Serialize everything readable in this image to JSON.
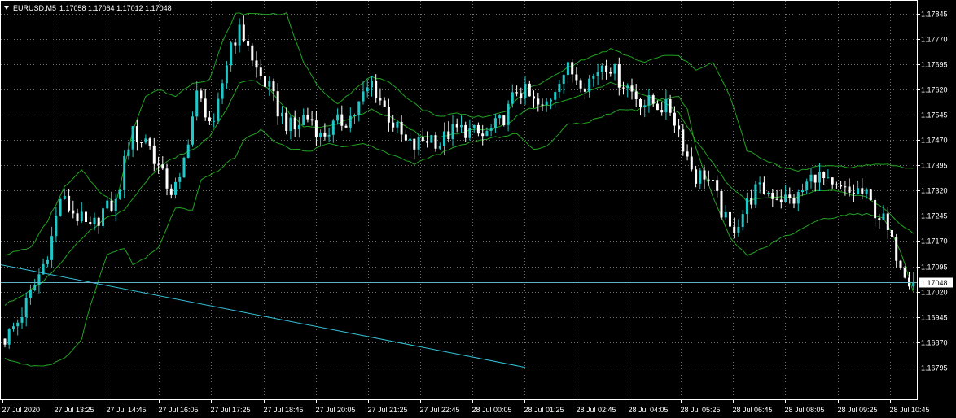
{
  "header": {
    "symbol": "EURUSD,M5",
    "ohlc": "1.17058 1.17064 1.17012 1.17048",
    "arrow_icon": "triangle-down-icon"
  },
  "colors": {
    "background": "#000000",
    "grid": "#c8c8c8",
    "frame": "#ffffff",
    "bull_candle": "#1fc8c8",
    "bear_candle": "#ffffff",
    "bands": "#22a322",
    "trendline": "#35c0d6",
    "bid_line": "#5fb3c3"
  },
  "chart_data": {
    "type": "candlestick",
    "title": "EURUSD,M5",
    "ylim": [
      1.16795,
      1.1787
    ],
    "y_ticks": [
      "1.17845",
      "1.17770",
      "1.17695",
      "1.17620",
      "1.17545",
      "1.17470",
      "1.17395",
      "1.17320",
      "1.17245",
      "1.17170",
      "1.17095",
      "1.17020",
      "1.16945",
      "1.16870",
      "1.16795"
    ],
    "x_ticks": [
      "27 Jul 2020",
      "27 Jul 13:25",
      "27 Jul 14:45",
      "27 Jul 16:05",
      "27 Jul 17:25",
      "27 Jul 18:45",
      "27 Jul 20:05",
      "27 Jul 21:25",
      "27 Jul 22:45",
      "28 Jul 00:05",
      "28 Jul 01:25",
      "28 Jul 02:45",
      "28 Jul 04:05",
      "28 Jul 05:25",
      "28 Jul 06:45",
      "28 Jul 08:05",
      "28 Jul 09:25",
      "28 Jul 10:45"
    ],
    "current_price": "1.17048",
    "price_path": [
      [
        0,
        1.1688
      ],
      [
        3,
        1.1693
      ],
      [
        6,
        1.1701
      ],
      [
        9,
        1.171
      ],
      [
        11,
        1.1718
      ],
      [
        13,
        1.173
      ],
      [
        15,
        1.1727
      ],
      [
        18,
        1.1723
      ],
      [
        20,
        1.172
      ],
      [
        23,
        1.1726
      ],
      [
        26,
        1.1728
      ],
      [
        28,
        1.174
      ],
      [
        30,
        1.1752
      ],
      [
        31,
        1.1746
      ],
      [
        33,
        1.1748
      ],
      [
        35,
        1.1742
      ],
      [
        37,
        1.1736
      ],
      [
        39,
        1.1732
      ],
      [
        41,
        1.1734
      ],
      [
        43,
        1.1748
      ],
      [
        45,
        1.176
      ],
      [
        47,
        1.1756
      ],
      [
        49,
        1.175
      ],
      [
        51,
        1.1764
      ],
      [
        53,
        1.1776
      ],
      [
        55,
        1.1779
      ],
      [
        57,
        1.1776
      ],
      [
        58,
        1.177
      ],
      [
        60,
        1.1766
      ],
      [
        62,
        1.1762
      ],
      [
        64,
        1.1756
      ],
      [
        66,
        1.1752
      ],
      [
        68,
        1.175
      ],
      [
        70,
        1.1754
      ],
      [
        72,
        1.1753
      ],
      [
        74,
        1.1748
      ],
      [
        76,
        1.175
      ],
      [
        78,
        1.1752
      ],
      [
        80,
        1.1753
      ],
      [
        82,
        1.1755
      ],
      [
        84,
        1.176
      ],
      [
        86,
        1.1764
      ],
      [
        88,
        1.1759
      ],
      [
        90,
        1.1754
      ],
      [
        92,
        1.175
      ],
      [
        94,
        1.1746
      ],
      [
        96,
        1.1745
      ],
      [
        98,
        1.1747
      ],
      [
        100,
        1.1748
      ],
      [
        102,
        1.1746
      ],
      [
        104,
        1.1749
      ],
      [
        106,
        1.175
      ],
      [
        108,
        1.175
      ],
      [
        110,
        1.1749
      ],
      [
        112,
        1.1748
      ],
      [
        114,
        1.175
      ],
      [
        116,
        1.1752
      ],
      [
        118,
        1.1756
      ],
      [
        120,
        1.1762
      ],
      [
        122,
        1.1761
      ],
      [
        124,
        1.1758
      ],
      [
        126,
        1.1756
      ],
      [
        128,
        1.176
      ],
      [
        130,
        1.1766
      ],
      [
        132,
        1.1768
      ],
      [
        134,
        1.1766
      ],
      [
        136,
        1.1764
      ],
      [
        138,
        1.1766
      ],
      [
        140,
        1.177
      ],
      [
        142,
        1.1769
      ],
      [
        144,
        1.1765
      ],
      [
        146,
        1.1763
      ],
      [
        148,
        1.176
      ],
      [
        150,
        1.1758
      ],
      [
        152,
        1.1758
      ],
      [
        154,
        1.1757
      ],
      [
        156,
        1.1756
      ],
      [
        158,
        1.175
      ],
      [
        160,
        1.1742
      ],
      [
        162,
        1.1736
      ],
      [
        164,
        1.1737
      ],
      [
        166,
        1.1733
      ],
      [
        168,
        1.1726
      ],
      [
        170,
        1.172
      ],
      [
        172,
        1.1723
      ],
      [
        174,
        1.1728
      ],
      [
        176,
        1.1732
      ],
      [
        178,
        1.1732
      ],
      [
        180,
        1.1731
      ],
      [
        182,
        1.173
      ],
      [
        184,
        1.1729
      ],
      [
        186,
        1.173
      ],
      [
        188,
        1.1734
      ],
      [
        190,
        1.1737
      ],
      [
        192,
        1.1735
      ],
      [
        194,
        1.1732
      ],
      [
        196,
        1.1732
      ],
      [
        198,
        1.1731
      ],
      [
        200,
        1.1732
      ],
      [
        202,
        1.173
      ],
      [
        204,
        1.1726
      ],
      [
        206,
        1.1723
      ],
      [
        208,
        1.1716
      ],
      [
        210,
        1.1711
      ],
      [
        212,
        1.1706
      ],
      [
        213,
        1.17048
      ]
    ],
    "bollinger_upper": [
      [
        0,
        1.1713
      ],
      [
        6,
        1.1715
      ],
      [
        10,
        1.1723
      ],
      [
        14,
        1.1733
      ],
      [
        18,
        1.1738
      ],
      [
        22,
        1.1732
      ],
      [
        26,
        1.1728
      ],
      [
        30,
        1.175
      ],
      [
        33,
        1.176
      ],
      [
        36,
        1.1762
      ],
      [
        40,
        1.176
      ],
      [
        44,
        1.1764
      ],
      [
        48,
        1.1765
      ],
      [
        51,
        1.1776
      ],
      [
        54,
        1.17845
      ],
      [
        66,
        1.17845
      ],
      [
        70,
        1.177
      ],
      [
        74,
        1.1762
      ],
      [
        78,
        1.1758
      ],
      [
        82,
        1.1762
      ],
      [
        86,
        1.1766
      ],
      [
        90,
        1.1764
      ],
      [
        94,
        1.176
      ],
      [
        98,
        1.1756
      ],
      [
        102,
        1.1754
      ],
      [
        106,
        1.1755
      ],
      [
        110,
        1.1754
      ],
      [
        114,
        1.1754
      ],
      [
        118,
        1.1756
      ],
      [
        122,
        1.1762
      ],
      [
        126,
        1.1764
      ],
      [
        130,
        1.1767
      ],
      [
        134,
        1.177
      ],
      [
        138,
        1.1772
      ],
      [
        142,
        1.1774
      ],
      [
        146,
        1.1772
      ],
      [
        150,
        1.177
      ],
      [
        154,
        1.1772
      ],
      [
        158,
        1.1772
      ],
      [
        162,
        1.1768
      ],
      [
        166,
        1.177
      ],
      [
        170,
        1.176
      ],
      [
        174,
        1.1744
      ],
      [
        178,
        1.1741
      ],
      [
        182,
        1.1739
      ],
      [
        186,
        1.1738
      ],
      [
        190,
        1.1739
      ],
      [
        194,
        1.17395
      ],
      [
        198,
        1.1739
      ],
      [
        202,
        1.17395
      ],
      [
        206,
        1.174
      ],
      [
        210,
        1.1739
      ],
      [
        213,
        1.17385
      ]
    ],
    "bollinger_middle": [
      [
        0,
        1.1698
      ],
      [
        4,
        1.1701
      ],
      [
        8,
        1.1704
      ],
      [
        12,
        1.1709
      ],
      [
        16,
        1.1715
      ],
      [
        20,
        1.172
      ],
      [
        24,
        1.1724
      ],
      [
        28,
        1.1726
      ],
      [
        32,
        1.1733
      ],
      [
        36,
        1.1739
      ],
      [
        40,
        1.1742
      ],
      [
        44,
        1.1744
      ],
      [
        48,
        1.1748
      ],
      [
        52,
        1.1756
      ],
      [
        55,
        1.1764
      ],
      [
        58,
        1.1765
      ],
      [
        62,
        1.1762
      ],
      [
        66,
        1.1756
      ],
      [
        70,
        1.1751
      ],
      [
        74,
        1.1751
      ],
      [
        78,
        1.1752
      ],
      [
        82,
        1.1754
      ],
      [
        86,
        1.1756
      ],
      [
        90,
        1.1754
      ],
      [
        94,
        1.1751
      ],
      [
        98,
        1.1748
      ],
      [
        102,
        1.1748
      ],
      [
        106,
        1.1749
      ],
      [
        110,
        1.175
      ],
      [
        114,
        1.175
      ],
      [
        118,
        1.1752
      ],
      [
        122,
        1.1756
      ],
      [
        126,
        1.1757
      ],
      [
        130,
        1.1758
      ],
      [
        134,
        1.176
      ],
      [
        138,
        1.1762
      ],
      [
        142,
        1.1764
      ],
      [
        146,
        1.1763
      ],
      [
        150,
        1.176
      ],
      [
        154,
        1.1759
      ],
      [
        158,
        1.1755
      ],
      [
        162,
        1.1747
      ],
      [
        166,
        1.174
      ],
      [
        170,
        1.1733
      ],
      [
        174,
        1.1729
      ],
      [
        178,
        1.173
      ],
      [
        182,
        1.173
      ],
      [
        186,
        1.173
      ],
      [
        190,
        1.1732
      ],
      [
        194,
        1.1732
      ],
      [
        198,
        1.1731
      ],
      [
        202,
        1.173
      ],
      [
        206,
        1.1727
      ],
      [
        210,
        1.1722
      ],
      [
        213,
        1.1719
      ]
    ],
    "bollinger_lower": [
      [
        0,
        1.1682
      ],
      [
        6,
        1.168
      ],
      [
        10,
        1.168
      ],
      [
        14,
        1.1682
      ],
      [
        18,
        1.1688
      ],
      [
        20,
        1.1698
      ],
      [
        24,
        1.1713
      ],
      [
        28,
        1.1715
      ],
      [
        30,
        1.171
      ],
      [
        33,
        1.1712
      ],
      [
        36,
        1.1715
      ],
      [
        40,
        1.1727
      ],
      [
        44,
        1.1726
      ],
      [
        46,
        1.1735
      ],
      [
        50,
        1.1738
      ],
      [
        54,
        1.1742
      ],
      [
        56,
        1.1747
      ],
      [
        60,
        1.175
      ],
      [
        64,
        1.1746
      ],
      [
        68,
        1.1744
      ],
      [
        72,
        1.1744
      ],
      [
        76,
        1.1746
      ],
      [
        80,
        1.1745
      ],
      [
        84,
        1.1746
      ],
      [
        88,
        1.1744
      ],
      [
        92,
        1.1742
      ],
      [
        96,
        1.174
      ],
      [
        100,
        1.1742
      ],
      [
        104,
        1.1744
      ],
      [
        108,
        1.1746
      ],
      [
        112,
        1.1747
      ],
      [
        116,
        1.1748
      ],
      [
        120,
        1.1749
      ],
      [
        124,
        1.1744
      ],
      [
        128,
        1.1746
      ],
      [
        132,
        1.1752
      ],
      [
        136,
        1.1752
      ],
      [
        140,
        1.1754
      ],
      [
        144,
        1.1756
      ],
      [
        148,
        1.1756
      ],
      [
        152,
        1.1758
      ],
      [
        154,
        1.1759
      ],
      [
        158,
        1.176
      ],
      [
        160,
        1.1756
      ],
      [
        162,
        1.1745
      ],
      [
        166,
        1.173
      ],
      [
        170,
        1.1718
      ],
      [
        174,
        1.1713
      ],
      [
        178,
        1.1715
      ],
      [
        182,
        1.1718
      ],
      [
        186,
        1.172
      ],
      [
        190,
        1.1723
      ],
      [
        194,
        1.1724
      ],
      [
        198,
        1.1725
      ],
      [
        202,
        1.1725
      ],
      [
        206,
        1.1724
      ],
      [
        208,
        1.1719
      ],
      [
        210,
        1.1714
      ],
      [
        213,
        1.1702
      ]
    ],
    "trendline": [
      [
        0,
        1.171
      ],
      [
        122,
        1.16795
      ]
    ]
  }
}
